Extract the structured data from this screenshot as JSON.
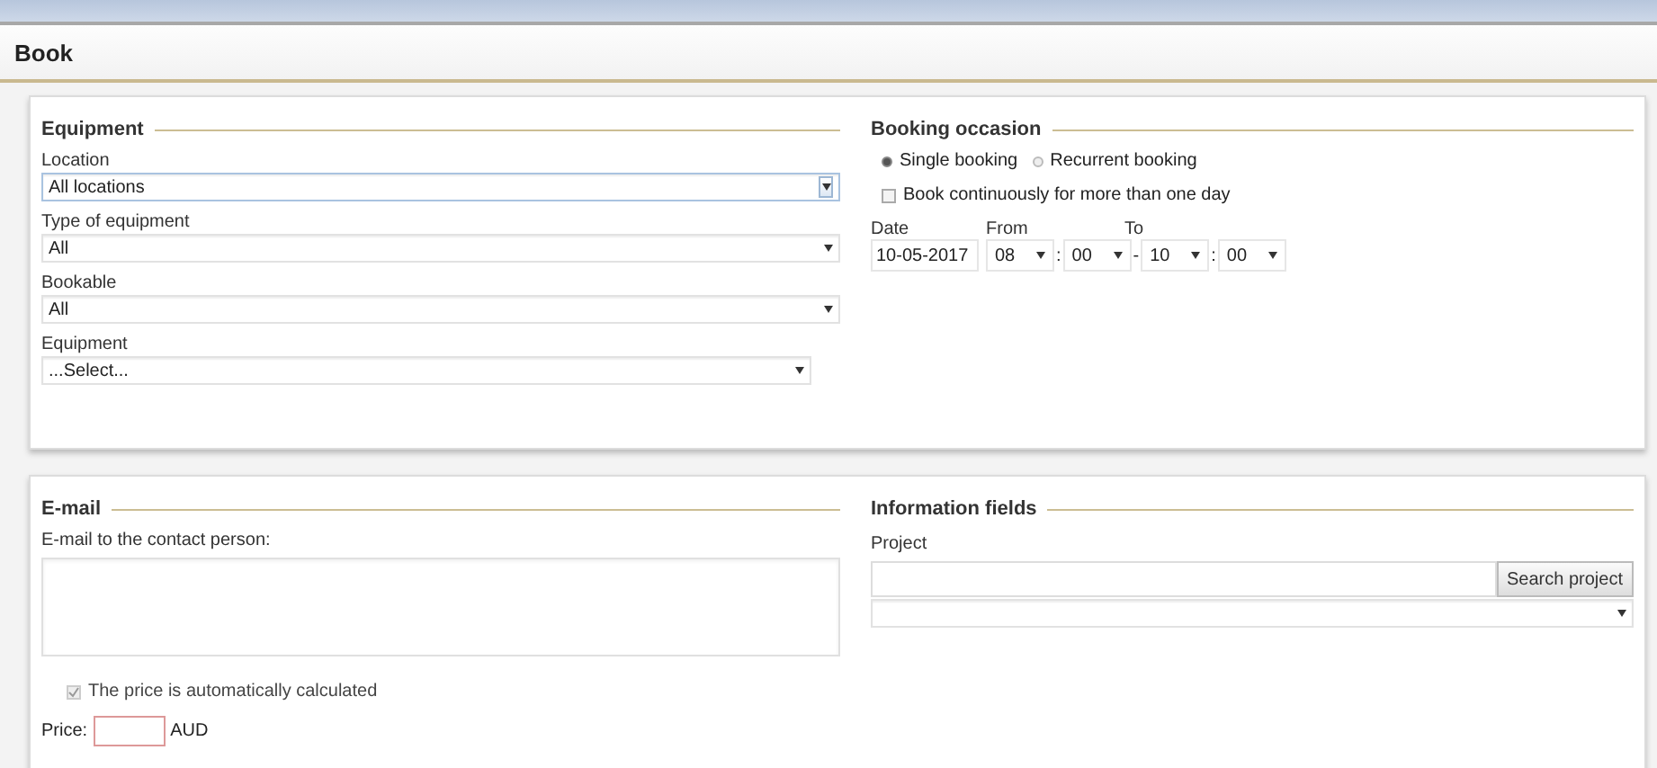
{
  "page": {
    "title": "Book"
  },
  "equipment": {
    "title": "Equipment",
    "fields": [
      {
        "label": "Location",
        "value": "All locations",
        "kind": "button-select"
      },
      {
        "label": "Type of equipment",
        "value": "All",
        "kind": "select"
      },
      {
        "label": "Bookable",
        "value": "All",
        "kind": "select"
      },
      {
        "label": "Equipment",
        "value": "...Select...",
        "kind": "short-select"
      }
    ]
  },
  "booking": {
    "title": "Booking occasion",
    "options": [
      {
        "label": "Single booking",
        "selected": true
      },
      {
        "label": "Recurrent booking",
        "selected": false
      }
    ],
    "continuous": {
      "label": "Book continuously for more than one day",
      "checked": false
    },
    "date": {
      "label": "Date",
      "value": "10-05-2017"
    },
    "from_label": "From",
    "to_label": "To",
    "time": [
      {
        "kind": "select",
        "value": "08"
      },
      {
        "kind": "sep",
        "text": ":"
      },
      {
        "kind": "select",
        "value": "00"
      },
      {
        "kind": "sep",
        "text": "-"
      },
      {
        "kind": "select",
        "value": "10"
      },
      {
        "kind": "sep",
        "text": ":"
      },
      {
        "kind": "select",
        "value": "00"
      }
    ]
  },
  "email": {
    "title": "E-mail",
    "label": "E-mail to the contact person:",
    "auto_price": {
      "label": "The price is automatically calculated",
      "checked": true,
      "disabled": true
    },
    "price_label": "Price:",
    "price_invalid": true,
    "currency": "AUD"
  },
  "info": {
    "title": "Information fields",
    "label": "Project",
    "button": "Search project"
  }
}
